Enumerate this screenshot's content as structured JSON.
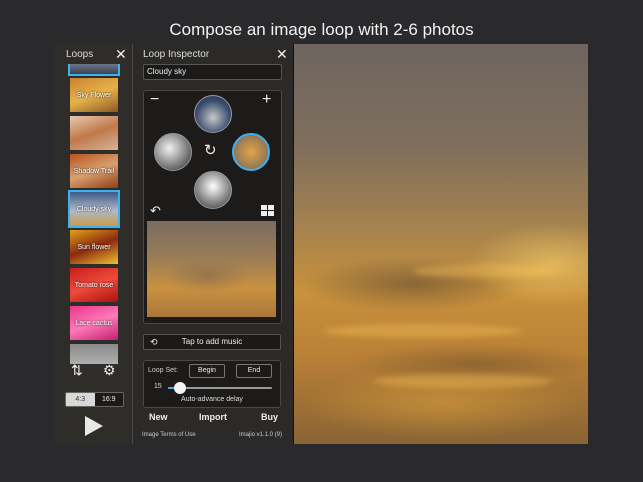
{
  "headline": "Compose an image loop with 2-6 photos",
  "loops_panel": {
    "title": "Loops",
    "close_icon": "close-icon",
    "items": [
      {
        "label": "",
        "bg": "linear-gradient(180deg,#6a7688,#3b4250)"
      },
      {
        "label": "Sky Flower",
        "bg": "linear-gradient(160deg,#c7822f,#e8b24a 50%,#8a5a22)"
      },
      {
        "label": "",
        "bg": "linear-gradient(160deg,#e8c9b0,#c0794a 50%,#d7b29a)"
      },
      {
        "label": "Shadow Trail",
        "bg": "linear-gradient(160deg,#b8521e,#d8a070 50%,#8f3f17)"
      },
      {
        "label": "Cloudy sky",
        "bg": "linear-gradient(180deg,#3d5a88,#b0b9c6 55%,#c89a4a)",
        "selected": true
      },
      {
        "label": "Sun flower",
        "bg": "linear-gradient(160deg,#e0a01a,#8a2a10 50%,#f0c030)"
      },
      {
        "label": "Tomato rose",
        "bg": "linear-gradient(160deg,#c71e1e,#f04a3a 50%,#a81010)"
      },
      {
        "label": "Lace cactus",
        "bg": "linear-gradient(160deg,#e8358a,#ff7ab8 50%,#c02070)"
      },
      {
        "label": "",
        "bg": "linear-gradient(180deg,#8a8a8a,#c8c8c8)"
      }
    ],
    "reorder_icon": "swap-arrows-icon",
    "settings_icon": "gear-icon",
    "ratio_options": [
      "4:3",
      "16:9"
    ],
    "ratio_selected": "4:3",
    "play_icon": "play-icon"
  },
  "inspector": {
    "title": "Loop Inspector",
    "close_icon": "close-icon",
    "loop_name": "Cloudy sky",
    "remove_icon": "minus-icon",
    "add_icon": "plus-icon",
    "rotate_icon": "rotate-icon",
    "undo_icon": "undo-icon",
    "grid_icon": "grid-icon",
    "photos": [
      {
        "name": "photo-top",
        "bg": "radial-gradient(circle at 50% 60%,#c8c8c8,#3a4d70 60%,#1e2c48)"
      },
      {
        "name": "photo-left",
        "bg": "radial-gradient(circle at 40% 40%,#f2f2f2,#7a7a7a 60%,#222)"
      },
      {
        "name": "photo-right",
        "bg": "radial-gradient(circle at 50% 50%,#e0a448,#9a7a52 65%,#6b5a4a)",
        "selected": true
      },
      {
        "name": "photo-bottom",
        "bg": "radial-gradient(circle at 50% 40%,#ffffff,#8a8a8a 55%,#333)"
      }
    ],
    "music_label": "Tap to add music",
    "music_icon": "loop-icon",
    "loop_set": {
      "label": "Loop Set:",
      "begin_label": "Begin",
      "end_label": "End",
      "delay_value": "15",
      "slider_fraction": 0.12,
      "caption": "Auto-advance delay"
    },
    "actions": {
      "new": "New",
      "import": "Import",
      "buy": "Buy"
    },
    "terms": "Image Terms of Use",
    "version": "Imajio v1.1.0 (9)"
  },
  "colors": {
    "accent": "#3fb0f0"
  }
}
